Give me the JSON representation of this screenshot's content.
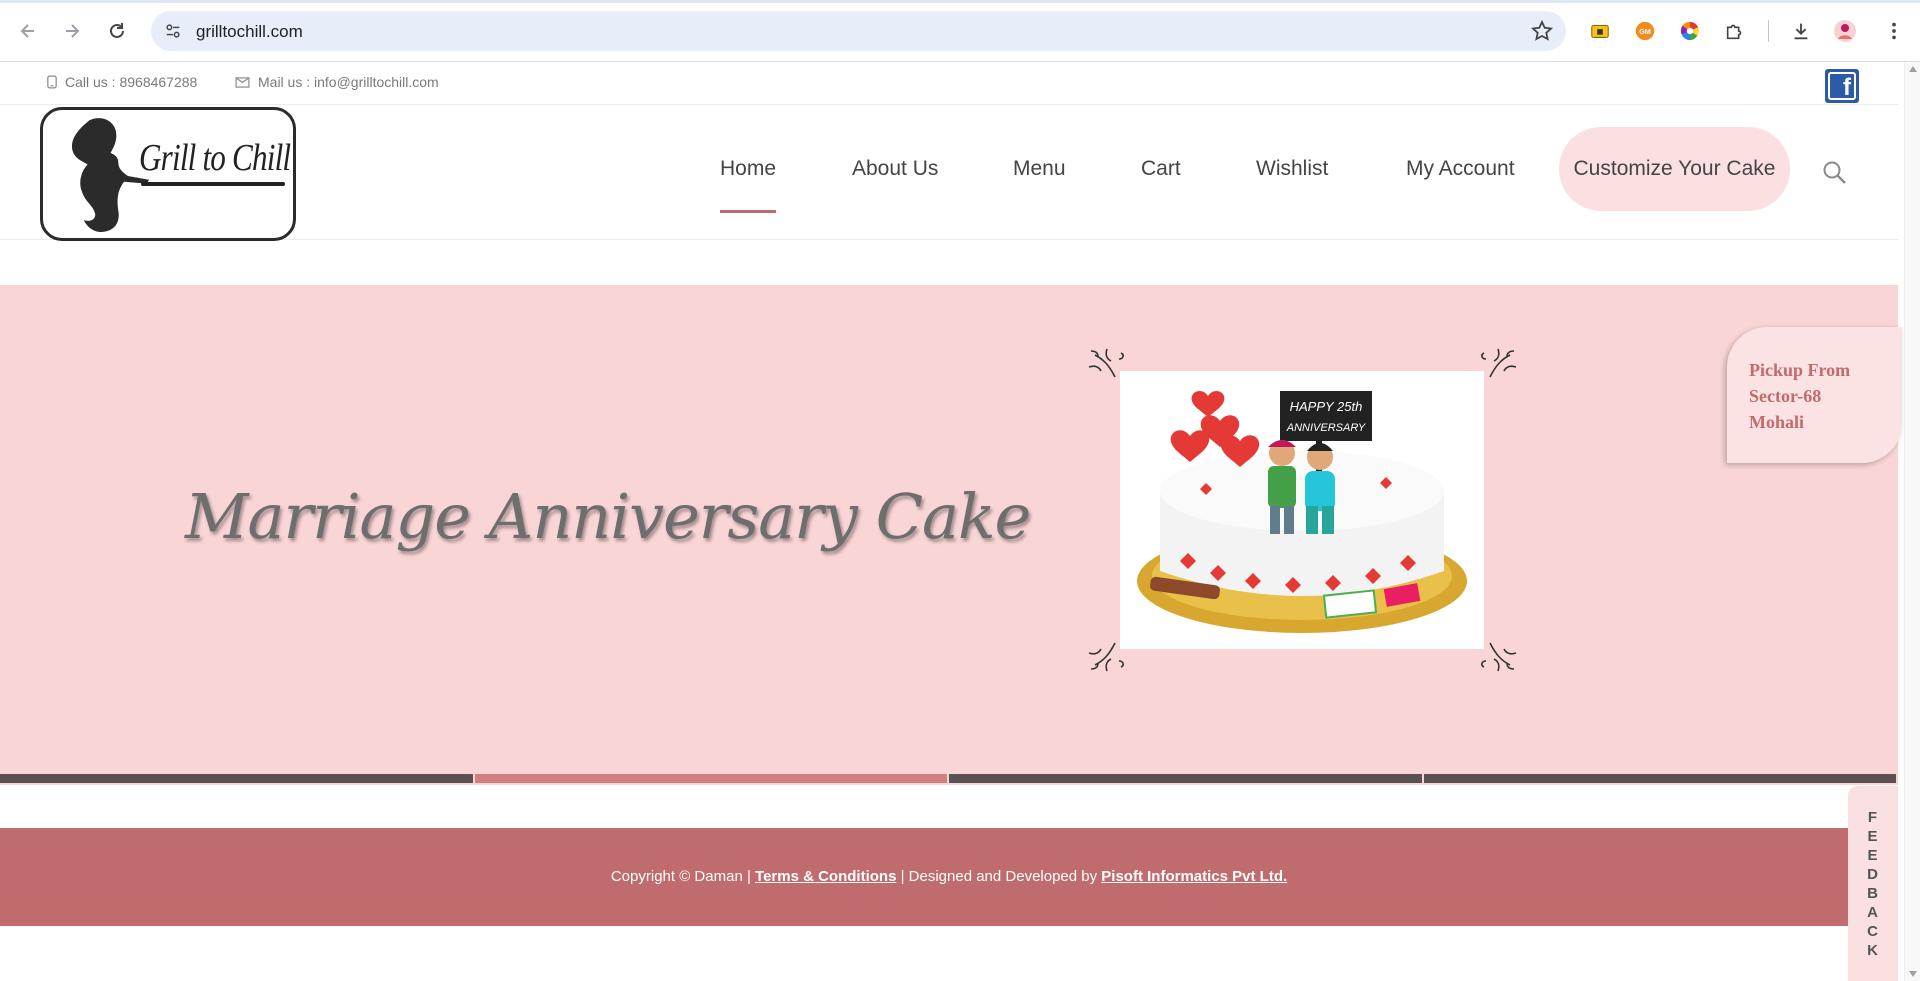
{
  "browser": {
    "url": "grilltochill.com"
  },
  "topbar": {
    "phone": "Call us : 8968467288",
    "email": "Mail us : info@grilltochill.com"
  },
  "logo": {
    "text": "Grill to Chill"
  },
  "menu": {
    "items": [
      "Home",
      "About Us",
      "Menu",
      "Cart",
      "Wishlist",
      "My Account"
    ],
    "active": "Home",
    "cta": "Customize Your Cake"
  },
  "hero": {
    "title": "Marriage Anniversary Cake",
    "cake_sign": "HAPPY 25th ANNIVERSARY",
    "slides_total": 4,
    "slide_active": 2
  },
  "pickup": {
    "line1": "Pickup From",
    "line2": "Sector-68",
    "line3": "Mohali"
  },
  "footer": {
    "prefix": "Copyright © Daman | ",
    "terms": "Terms & Conditions",
    "middle": " | Designed and Developed by ",
    "developer": "Pisoft Informatics Pvt Ltd."
  },
  "feedback": {
    "label": "FEEDBACK"
  },
  "colors": {
    "accent": "#c06b6d",
    "hero_bg": "#f9d5d5",
    "pill_bg": "#fbe0e1",
    "slider_dark": "#5a5153",
    "slider_active": "#d27f7f"
  }
}
